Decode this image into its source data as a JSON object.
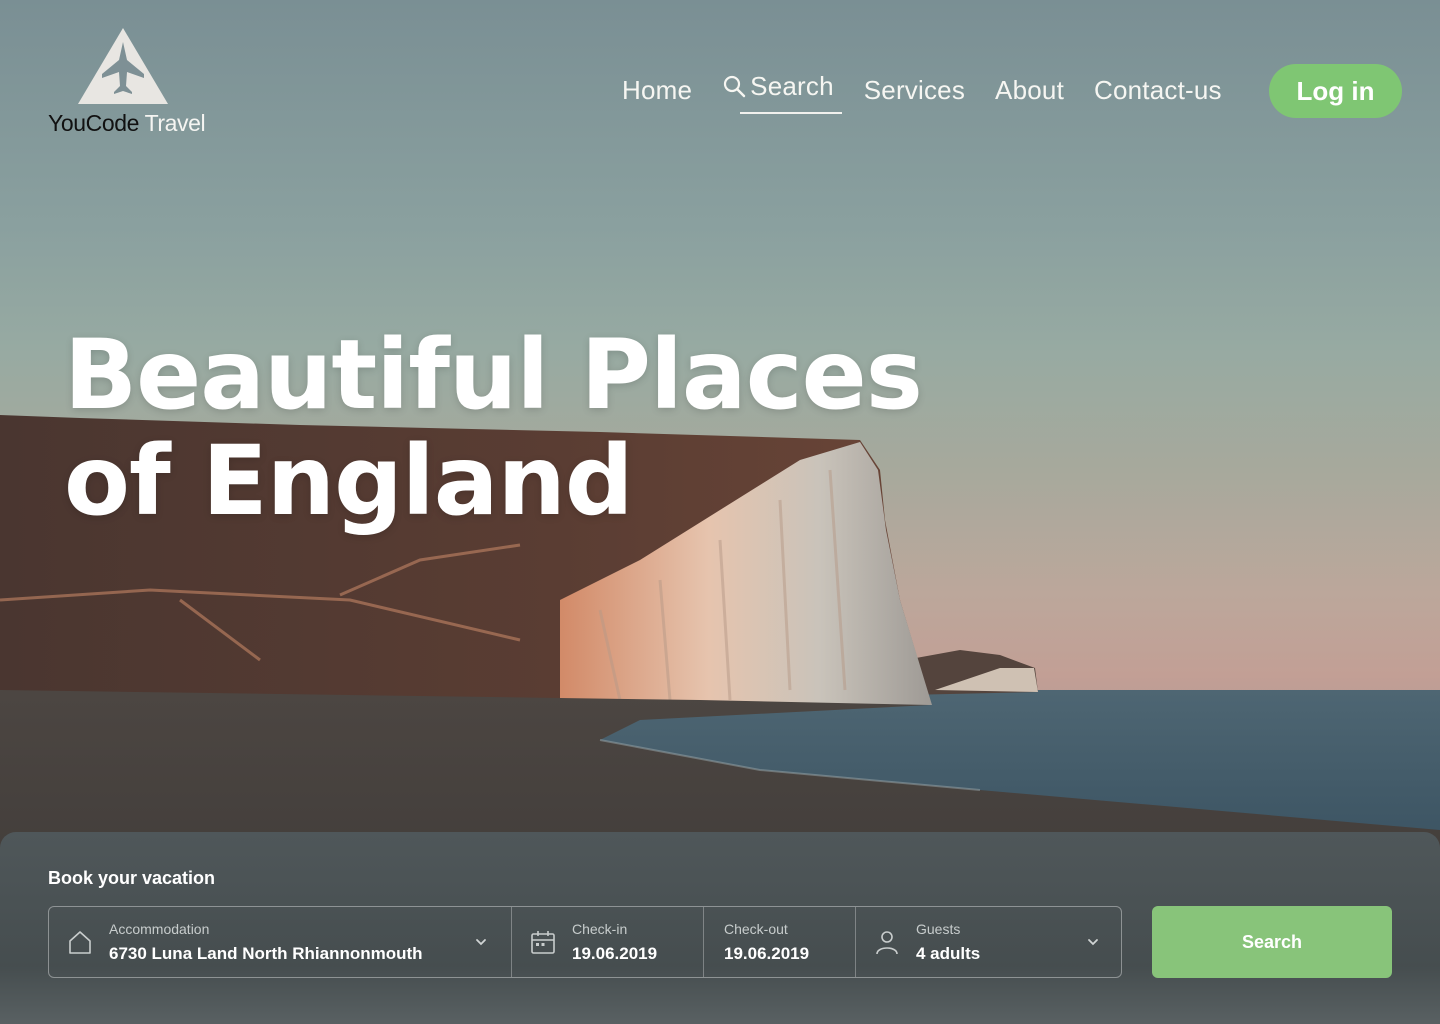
{
  "brand": {
    "name_part1": "YouCode",
    "name_part2": " Travel",
    "logo_icon": "mountain-plane-logo-icon"
  },
  "nav": {
    "items": [
      {
        "label": "Home"
      },
      {
        "label": "Search",
        "icon": "search-icon",
        "active": true
      },
      {
        "label": "Services"
      },
      {
        "label": "About"
      },
      {
        "label": "Contact-us"
      }
    ],
    "login_label": "Log in"
  },
  "hero": {
    "title_line1": "Beautiful Places",
    "title_line2": "of England"
  },
  "booking": {
    "title": "Book your vacation",
    "accommodation": {
      "label": "Accommodation",
      "value": "6730 Luna Land North Rhiannonmouth",
      "icon": "home-icon"
    },
    "checkin": {
      "label": "Check-in",
      "value": "19.06.2019",
      "icon": "calendar-icon"
    },
    "checkout": {
      "label": "Check-out",
      "value": "19.06.2019"
    },
    "guests": {
      "label": "Guests",
      "value": "4 adults",
      "icon": "user-icon"
    },
    "search_label": "Search"
  },
  "colors": {
    "accent": "#7fc673",
    "search_button": "#88c47a"
  }
}
